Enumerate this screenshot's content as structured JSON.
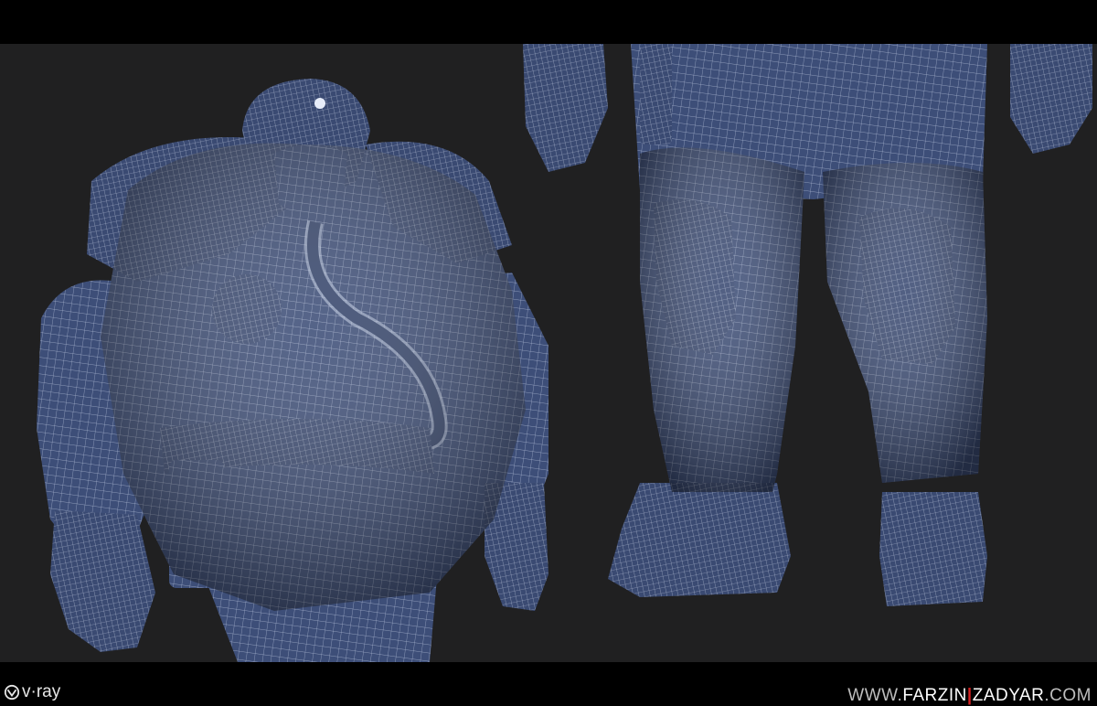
{
  "watermark": {
    "renderer_logo_text": "v·ray",
    "site_prefix": "WWW.",
    "site_name_first": "FARZIN",
    "site_separator": "|",
    "site_name_last": "ZADYAR",
    "site_suffix": ".COM"
  },
  "colors": {
    "background": "#202021",
    "letterbox": "#000000",
    "armor_base": "#3d4e78",
    "armor_shadow": "#243050",
    "wireframe": "#c9d3ea",
    "accent_red": "#d41f1f"
  }
}
